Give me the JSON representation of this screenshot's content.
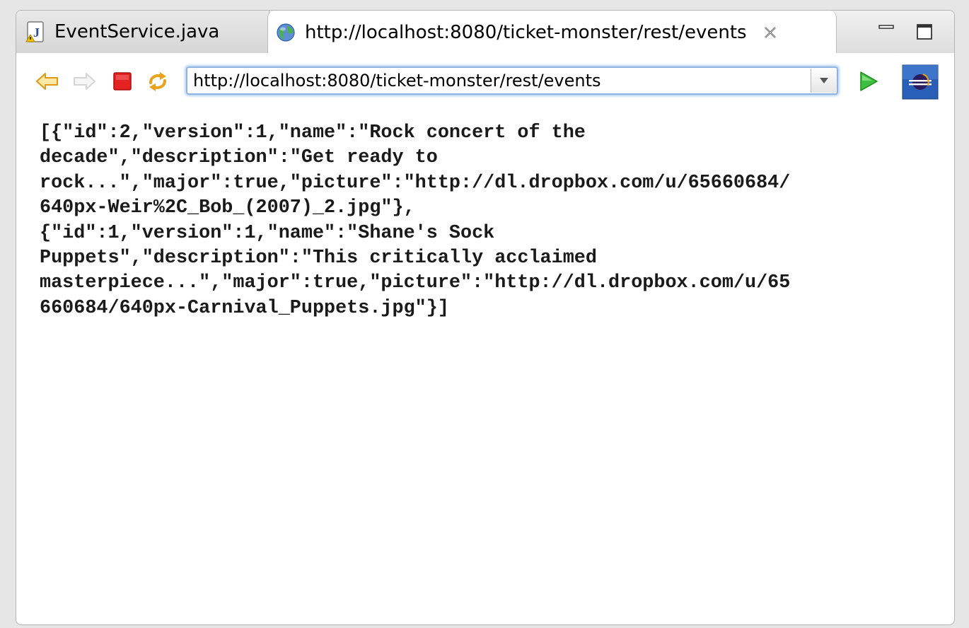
{
  "tabs": {
    "editor": {
      "label": "EventService.java",
      "icon": "java-file-icon"
    },
    "browser": {
      "label": "http://localhost:8080/ticket-monster/rest/events",
      "icon": "globe-icon",
      "close_icon": "close-icon"
    }
  },
  "window_controls": {
    "minimize_icon": "minimize-icon",
    "maximize_icon": "maximize-icon"
  },
  "toolbar": {
    "back_icon": "back-arrow-icon",
    "forward_icon": "forward-arrow-icon",
    "stop_icon": "stop-icon",
    "refresh_icon": "refresh-icon",
    "url_value": "http://localhost:8080/ticket-monster/rest/events",
    "dropdown_icon": "chevron-down-icon",
    "go_icon": "go-play-icon",
    "eclipse_icon": "eclipse-icon"
  },
  "content": {
    "lines": [
      "[{\"id\":2,\"version\":1,\"name\":\"Rock concert of the",
      "decade\",\"description\":\"Get ready to",
      "rock...\",\"major\":true,\"picture\":\"http://dl.dropbox.com/u/65660684/",
      "640px-Weir%2C_Bob_(2007)_2.jpg\"},",
      "{\"id\":1,\"version\":1,\"name\":\"Shane's Sock",
      "Puppets\",\"description\":\"This critically acclaimed",
      "masterpiece...\",\"major\":true,\"picture\":\"http://dl.dropbox.com/u/65",
      "660684/640px-Carnival_Puppets.jpg\"}]"
    ]
  },
  "colors": {
    "accent_blue": "#8fb4e3",
    "stop_red": "#e02020",
    "arrow_orange": "#f0a020",
    "go_green": "#2eaa2e"
  }
}
